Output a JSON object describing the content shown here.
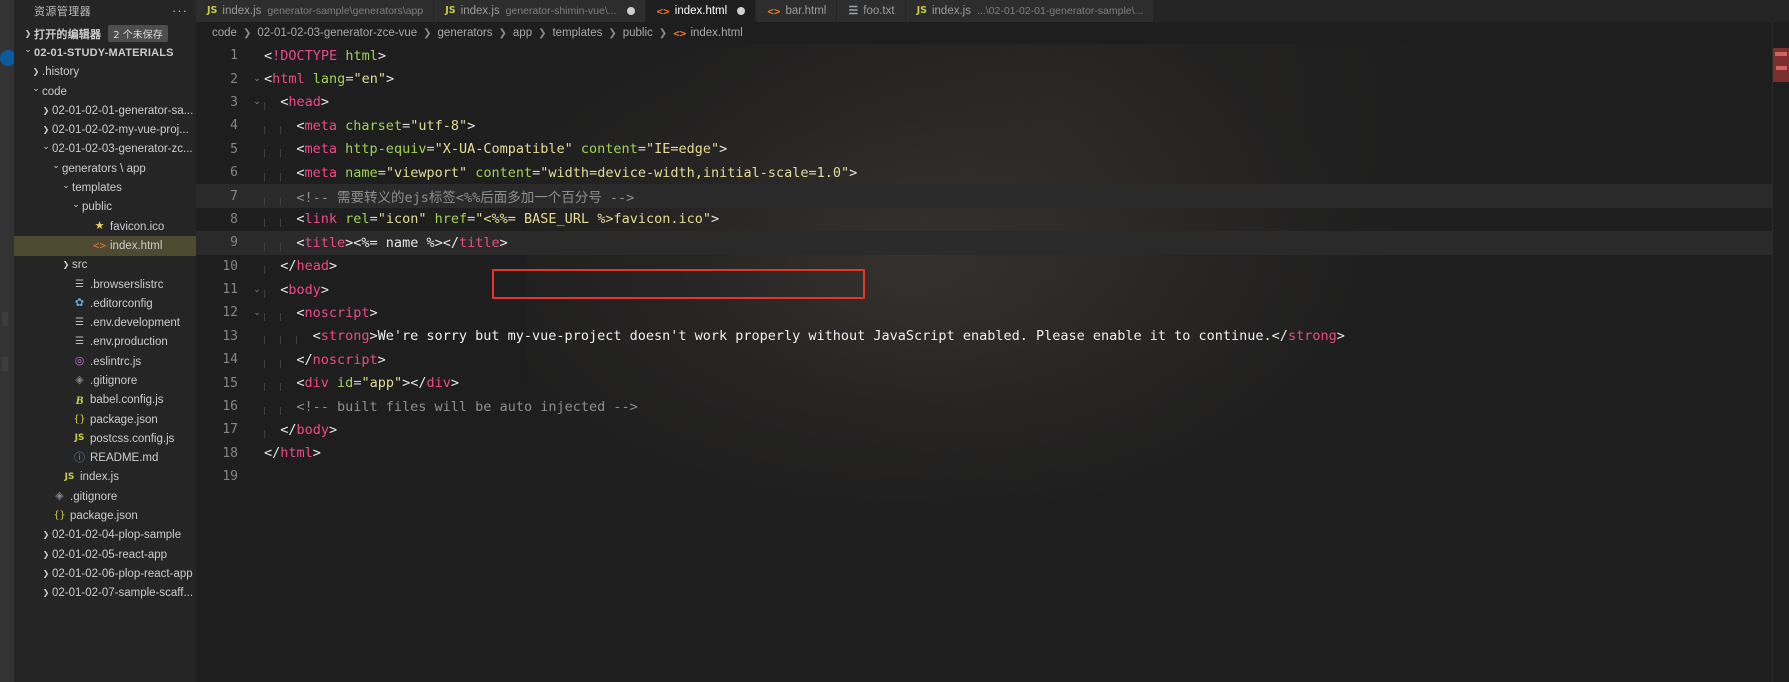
{
  "window": {
    "sidebar_title": "资源管理器",
    "more_actions": "···"
  },
  "sidebar": {
    "open_editors": {
      "label": "打开的编辑器",
      "badge": "2 个未保存"
    },
    "root_folder": "02-01-STUDY-MATERIALS",
    "items": [
      {
        "label": ".history",
        "twisty": "chevron-right",
        "indent": 1,
        "icon": ""
      },
      {
        "label": "code",
        "twisty": "chevron-down",
        "indent": 1,
        "icon": ""
      },
      {
        "label": "02-01-02-01-generator-sa...",
        "twisty": "chevron-right",
        "indent": 2,
        "icon": ""
      },
      {
        "label": "02-01-02-02-my-vue-proj...",
        "twisty": "chevron-right",
        "indent": 2,
        "icon": ""
      },
      {
        "label": "02-01-02-03-generator-zc...",
        "twisty": "chevron-down",
        "indent": 2,
        "icon": ""
      },
      {
        "label": "generators \\ app",
        "twisty": "chevron-down",
        "indent": 3,
        "icon": ""
      },
      {
        "label": "templates",
        "twisty": "chevron-down",
        "indent": 4,
        "icon": ""
      },
      {
        "label": "public",
        "twisty": "chevron-down",
        "indent": 5,
        "icon": ""
      },
      {
        "label": "favicon.ico",
        "twisty": "",
        "indent": 6,
        "icon": "star-icon"
      },
      {
        "label": "index.html",
        "twisty": "",
        "indent": 6,
        "icon": "html-icon",
        "selected": true
      },
      {
        "label": "src",
        "twisty": "chevron-right",
        "indent": 4,
        "icon": ""
      },
      {
        "label": ".browserslistrc",
        "twisty": "",
        "indent": 4,
        "icon": "config-icon"
      },
      {
        "label": ".editorconfig",
        "twisty": "",
        "indent": 4,
        "icon": "gear-icon"
      },
      {
        "label": ".env.development",
        "twisty": "",
        "indent": 4,
        "icon": "config-icon"
      },
      {
        "label": ".env.production",
        "twisty": "",
        "indent": 4,
        "icon": "config-icon"
      },
      {
        "label": ".eslintrc.js",
        "twisty": "",
        "indent": 4,
        "icon": "eslint-icon"
      },
      {
        "label": ".gitignore",
        "twisty": "",
        "indent": 4,
        "icon": "git-icon"
      },
      {
        "label": "babel.config.js",
        "twisty": "",
        "indent": 4,
        "icon": "babel-icon"
      },
      {
        "label": "package.json",
        "twisty": "",
        "indent": 4,
        "icon": "json-icon"
      },
      {
        "label": "postcss.config.js",
        "twisty": "",
        "indent": 4,
        "icon": "js-icon"
      },
      {
        "label": "README.md",
        "twisty": "",
        "indent": 4,
        "icon": "markdown-icon"
      },
      {
        "label": "index.js",
        "twisty": "",
        "indent": 3,
        "icon": "js-icon"
      },
      {
        "label": ".gitignore",
        "twisty": "",
        "indent": 2,
        "icon": "git-icon"
      },
      {
        "label": "package.json",
        "twisty": "",
        "indent": 2,
        "icon": "json-icon"
      },
      {
        "label": "02-01-02-04-plop-sample",
        "twisty": "chevron-right",
        "indent": 2,
        "icon": ""
      },
      {
        "label": "02-01-02-05-react-app",
        "twisty": "chevron-right",
        "indent": 2,
        "icon": ""
      },
      {
        "label": "02-01-02-06-plop-react-app",
        "twisty": "chevron-right",
        "indent": 2,
        "icon": ""
      },
      {
        "label": "02-01-02-07-sample-scaff...",
        "twisty": "chevron-right",
        "indent": 2,
        "icon": ""
      }
    ]
  },
  "tabs": [
    {
      "name": "index.js",
      "desc": "generator-sample\\generators\\app",
      "icon": "js-icon",
      "active": false,
      "dirty": false
    },
    {
      "name": "index.js",
      "desc": "generator-shimin-vue\\...",
      "icon": "js-icon",
      "active": false,
      "dirty": true
    },
    {
      "name": "index.html",
      "desc": "",
      "icon": "html-icon",
      "active": true,
      "dirty": true
    },
    {
      "name": "bar.html",
      "desc": "",
      "icon": "html-icon",
      "active": false,
      "dirty": false
    },
    {
      "name": "foo.txt",
      "desc": "",
      "icon": "txt-icon",
      "active": false,
      "dirty": false
    },
    {
      "name": "index.js",
      "desc": "...\\02-01-02-01-generator-sample\\...",
      "icon": "js-icon",
      "active": false,
      "dirty": false
    }
  ],
  "breadcrumb": [
    {
      "label": "code",
      "icon": ""
    },
    {
      "label": "02-01-02-03-generator-zce-vue",
      "icon": ""
    },
    {
      "label": "generators",
      "icon": ""
    },
    {
      "label": "app",
      "icon": ""
    },
    {
      "label": "templates",
      "icon": ""
    },
    {
      "label": "public",
      "icon": ""
    },
    {
      "label": "index.html",
      "icon": "html-icon"
    }
  ],
  "code": {
    "language": "html",
    "lines": [
      {
        "n": "1",
        "fold": "",
        "text": "<!DOCTYPE html>"
      },
      {
        "n": "2",
        "fold": "v",
        "text": "<html lang=\"en\">"
      },
      {
        "n": "3",
        "fold": "v",
        "text": "  <head>"
      },
      {
        "n": "4",
        "fold": "",
        "text": "    <meta charset=\"utf-8\">"
      },
      {
        "n": "5",
        "fold": "",
        "text": "    <meta http-equiv=\"X-UA-Compatible\" content=\"IE=edge\">"
      },
      {
        "n": "6",
        "fold": "",
        "text": "    <meta name=\"viewport\" content=\"width=device-width,initial-scale=1.0\">"
      },
      {
        "n": "7",
        "fold": "",
        "text": "    <!-- 需要转义的ejs标签<%%后面多加一个百分号 -->"
      },
      {
        "n": "8",
        "fold": "",
        "text": "    <link rel=\"icon\" href=\"<%%= BASE_URL %>favicon.ico\">"
      },
      {
        "n": "9",
        "fold": "",
        "text": "    <title><%= name %></title>"
      },
      {
        "n": "10",
        "fold": "",
        "text": "  </head>"
      },
      {
        "n": "11",
        "fold": "v",
        "text": "  <body>"
      },
      {
        "n": "12",
        "fold": "v",
        "text": "    <noscript>"
      },
      {
        "n": "13",
        "fold": "",
        "text": "      <strong>We're sorry but my-vue-project doesn't work properly without JavaScript enabled. Please enable it to continue.</strong>"
      },
      {
        "n": "14",
        "fold": "",
        "text": "    </noscript>"
      },
      {
        "n": "15",
        "fold": "",
        "text": "    <div id=\"app\"></div>"
      },
      {
        "n": "16",
        "fold": "",
        "text": "    <!-- built files will be auto injected -->"
      },
      {
        "n": "17",
        "fold": "",
        "text": "  </body>"
      },
      {
        "n": "18",
        "fold": "",
        "text": "</html>"
      },
      {
        "n": "19",
        "fold": "",
        "text": ""
      }
    ],
    "highlighted_line": "9",
    "highlight_color": "#e8332a"
  },
  "colors": {
    "tag": "#ec4a87",
    "attribute": "#9fd356",
    "string": "#e6db95",
    "comment": "#8e8e8e",
    "text": "#f0f0f0",
    "editor_bg": "#1e1e1e",
    "sidebar_bg": "#252526",
    "selection": "#4d4a32"
  }
}
